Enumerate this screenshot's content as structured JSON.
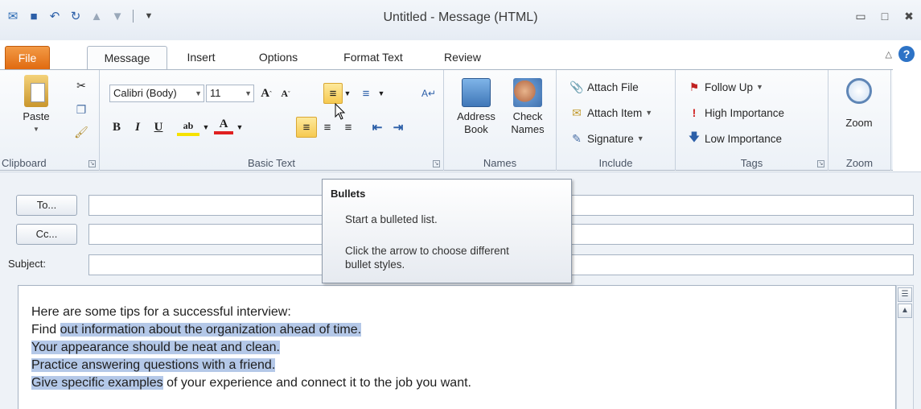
{
  "window": {
    "title": "Untitled  -  Message (HTML)"
  },
  "tabs": [
    {
      "label": "File"
    },
    {
      "label": "Message"
    },
    {
      "label": "Insert"
    },
    {
      "label": "Options"
    },
    {
      "label": "Format Text"
    },
    {
      "label": "Review"
    }
  ],
  "ribbon": {
    "clipboard": {
      "paste_label": "Paste",
      "group_label": "Clipboard"
    },
    "basic_text": {
      "font_name": "Calibri (Body)",
      "font_size": "11",
      "group_label": "Basic Text"
    },
    "names": {
      "address_book_line1": "Address",
      "address_book_line2": "Book",
      "check_names_line1": "Check",
      "check_names_line2": "Names",
      "group_label": "Names"
    },
    "include": {
      "attach_file": "Attach File",
      "attach_item": "Attach Item",
      "signature": "Signature",
      "group_label": "Include"
    },
    "tags": {
      "follow_up": "Follow Up",
      "high_importance": "High Importance",
      "low_importance": "Low Importance",
      "group_label": "Tags"
    },
    "zoom": {
      "zoom_label": "Zoom",
      "group_label": "Zoom"
    }
  },
  "form": {
    "to_button": "To...",
    "cc_button": "Cc...",
    "subject_label": "Subject:",
    "to_value": "",
    "cc_value": "",
    "subject_value": ""
  },
  "body": {
    "line1": "Here are some tips for a successful interview:",
    "line2_plain": "Find ",
    "line2_sel": "out information about the organization ahead of time.",
    "line3_sel": "Your appearance should be neat and clean.",
    "line4_sel": "Practice answering questions with a friend.",
    "line5_sel": "Give specific examples",
    "line5_plain": " of your experience and connect it to the job you want."
  },
  "tooltip": {
    "title": "Bullets",
    "line1": "Start a bulleted list.",
    "line2": "Click the arrow to choose different",
    "line3": "bullet styles."
  },
  "colors": {
    "file_tab": "#e06a10",
    "selection": "#b4c8e8",
    "highlight_button": "#f6c950",
    "help_icon": "#2d73c6"
  }
}
